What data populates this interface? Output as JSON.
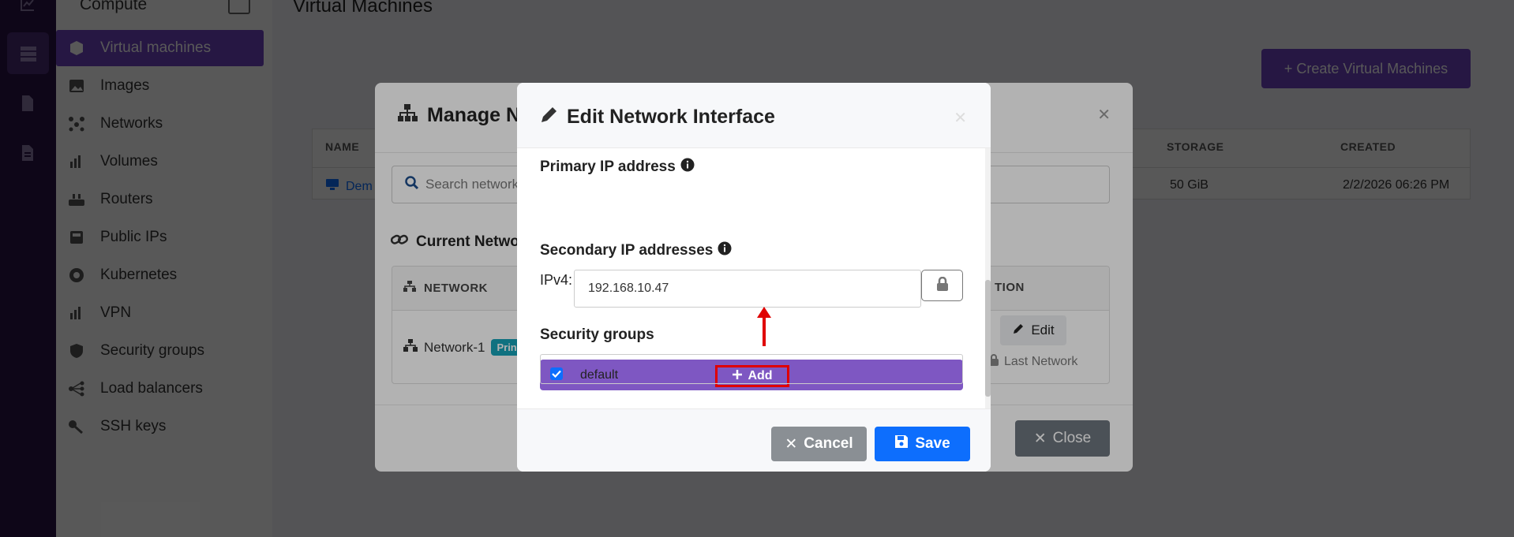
{
  "sidebar": {
    "header": "Compute",
    "items": [
      {
        "label": "Virtual machines",
        "icon": "cube-icon",
        "active": true
      },
      {
        "label": "Images",
        "icon": "image-icon"
      },
      {
        "label": "Networks",
        "icon": "network-icon"
      },
      {
        "label": "Volumes",
        "icon": "volume-icon"
      },
      {
        "label": "Routers",
        "icon": "router-icon"
      },
      {
        "label": "Public IPs",
        "icon": "public-ip-icon"
      },
      {
        "label": "Kubernetes",
        "icon": "kubernetes-icon"
      },
      {
        "label": "VPN",
        "icon": "vpn-icon"
      },
      {
        "label": "Security groups",
        "icon": "shield-icon"
      },
      {
        "label": "Load balancers",
        "icon": "load-balancer-icon"
      },
      {
        "label": "SSH keys",
        "icon": "key-icon"
      }
    ]
  },
  "main": {
    "title": "Virtual Machines",
    "create_button": "+ Create Virtual Machines",
    "table": {
      "headers": {
        "name": "NAME",
        "storage": "STORAGE",
        "created": "CREATED"
      },
      "row": {
        "name": "Dem",
        "storage": "50 GiB",
        "created": "2/2/2026 06:26 PM"
      }
    }
  },
  "manage_modal": {
    "title": "Manage Ne",
    "search_placeholder": "Search network",
    "current_title": "Current Netwo",
    "headers": {
      "network": "NETWORK",
      "action": "TION"
    },
    "row": {
      "network": "Network-1",
      "badge": "Prin",
      "edit": "Edit",
      "last_network": "Last Network"
    },
    "close_button": "Close"
  },
  "edit_modal": {
    "title": "Edit Network Interface",
    "primary_ip_label": "Primary IP address",
    "ipv4_label": "IPv4:",
    "ipv4_value": "192.168.10.47",
    "secondary_ip_label": "Secondary IP addresses",
    "add_button": "Add",
    "security_groups_label": "Security groups",
    "security_group_item": "default",
    "cancel_button": "Cancel",
    "save_button": "Save"
  },
  "colors": {
    "brand": "#6f42c1",
    "add_bar": "#7e57c2",
    "primary": "#0d6efd",
    "secondary": "#8a8f94",
    "highlight": "#e00000"
  }
}
